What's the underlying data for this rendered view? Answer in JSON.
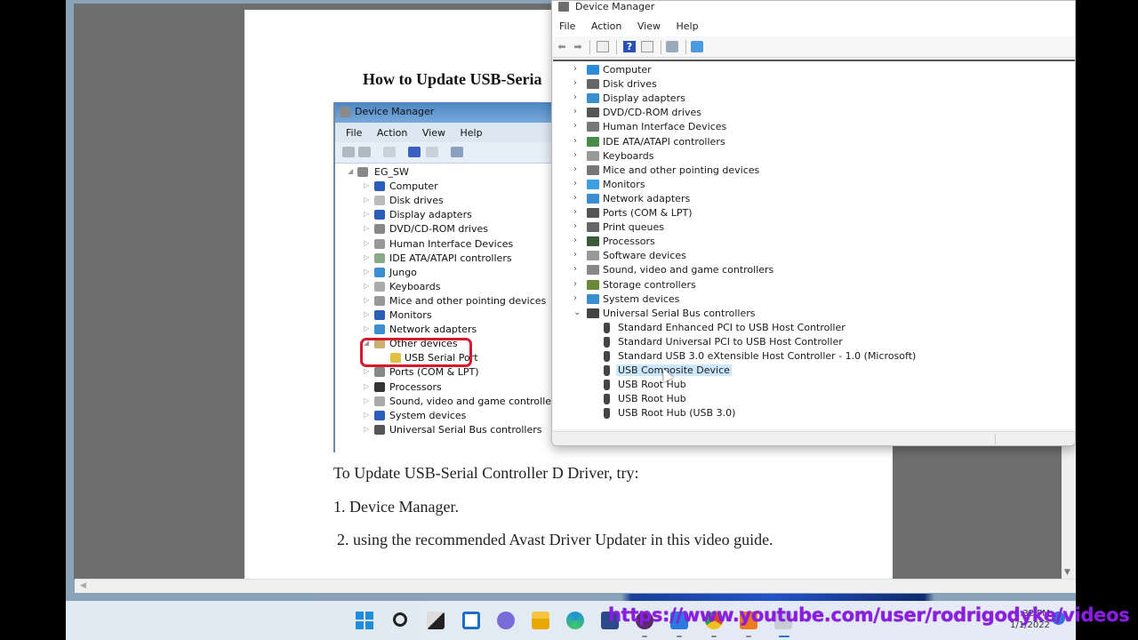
{
  "document": {
    "title": "How to Update USB-Seria",
    "lines": [
      "To Update USB-Serial Controller D Driver, try:",
      "1. Device Manager.",
      " 2. using the recommended Avast Driver Updater in this video guide."
    ]
  },
  "embedded_screenshot": {
    "title": "Device Manager",
    "menu": [
      "File",
      "Action",
      "View",
      "Help"
    ],
    "root": "EG_SW",
    "items": [
      "Computer",
      "Disk drives",
      "Display adapters",
      "DVD/CD-ROM drives",
      "Human Interface Devices",
      "IDE ATA/ATAPI controllers",
      "Jungo",
      "Keyboards",
      "Mice and other pointing devices",
      "Monitors",
      "Network adapters",
      "Other devices",
      "USB Serial Port",
      "Ports (COM & LPT)",
      "Processors",
      "Sound, video and game controllers",
      "System devices",
      "Universal Serial Bus controllers"
    ],
    "highlight_color": "#d8182c"
  },
  "device_manager": {
    "title": "Device Manager",
    "menu": [
      "File",
      "Action",
      "View",
      "Help"
    ],
    "toolbar": [
      "back-icon",
      "forward-icon",
      "show-hide-tree-icon",
      "help-icon",
      "properties-icon",
      "update-driver-icon",
      "scan-hardware-icon"
    ],
    "categories": [
      {
        "label": "Computer",
        "icon": "computer-icon",
        "color": "#2e8bd8"
      },
      {
        "label": "Disk drives",
        "icon": "disk-icon",
        "color": "#666666"
      },
      {
        "label": "Display adapters",
        "icon": "display-adapter-icon",
        "color": "#3a8fd0"
      },
      {
        "label": "DVD/CD-ROM drives",
        "icon": "dvd-icon",
        "color": "#555555"
      },
      {
        "label": "Human Interface Devices",
        "icon": "hid-icon",
        "color": "#777777"
      },
      {
        "label": "IDE ATA/ATAPI controllers",
        "icon": "ide-icon",
        "color": "#4a8a4a"
      },
      {
        "label": "Keyboards",
        "icon": "keyboard-icon",
        "color": "#999999"
      },
      {
        "label": "Mice and other pointing devices",
        "icon": "mouse-icon",
        "color": "#777777"
      },
      {
        "label": "Monitors",
        "icon": "monitor-icon",
        "color": "#3aa0e0"
      },
      {
        "label": "Network adapters",
        "icon": "network-icon",
        "color": "#3a8fd0"
      },
      {
        "label": "Ports (COM & LPT)",
        "icon": "port-icon",
        "color": "#555555"
      },
      {
        "label": "Print queues",
        "icon": "printer-icon",
        "color": "#666666"
      },
      {
        "label": "Processors",
        "icon": "processor-icon",
        "color": "#3a5a3a"
      },
      {
        "label": "Software devices",
        "icon": "software-device-icon",
        "color": "#999999"
      },
      {
        "label": "Sound, video and game controllers",
        "icon": "speaker-icon",
        "color": "#888888"
      },
      {
        "label": "Storage controllers",
        "icon": "storage-icon",
        "color": "#6a8a3a"
      },
      {
        "label": "System devices",
        "icon": "system-icon",
        "color": "#3a8fd0"
      },
      {
        "label": "Universal Serial Bus controllers",
        "icon": "usb-icon",
        "color": "#444444",
        "expanded": true
      }
    ],
    "usb_children": [
      "Standard Enhanced PCI to USB Host Controller",
      "Standard Universal PCI to USB Host Controller",
      "Standard USB 3.0 eXtensible Host Controller - 1.0 (Microsoft)",
      "USB Composite Device",
      "USB Root Hub",
      "USB Root Hub",
      "USB Root Hub (USB 3.0)"
    ],
    "selected": "USB Composite Device",
    "selection_color": "#cce8ff"
  },
  "taskbar": {
    "icons": [
      "start-icon",
      "search-icon",
      "task-view-icon",
      "widgets-icon",
      "chat-icon",
      "file-explorer-icon",
      "edge-icon",
      "store-icon",
      "app-icon",
      "mail-icon",
      "chrome-icon",
      "office-icon",
      "active-app-icon"
    ],
    "time": "5:32 PM",
    "date": "1/1/2022"
  },
  "overlay": {
    "url": "https://www.youtube.com/user/rodrigodyke/videos",
    "color": "#8a1ee0"
  }
}
